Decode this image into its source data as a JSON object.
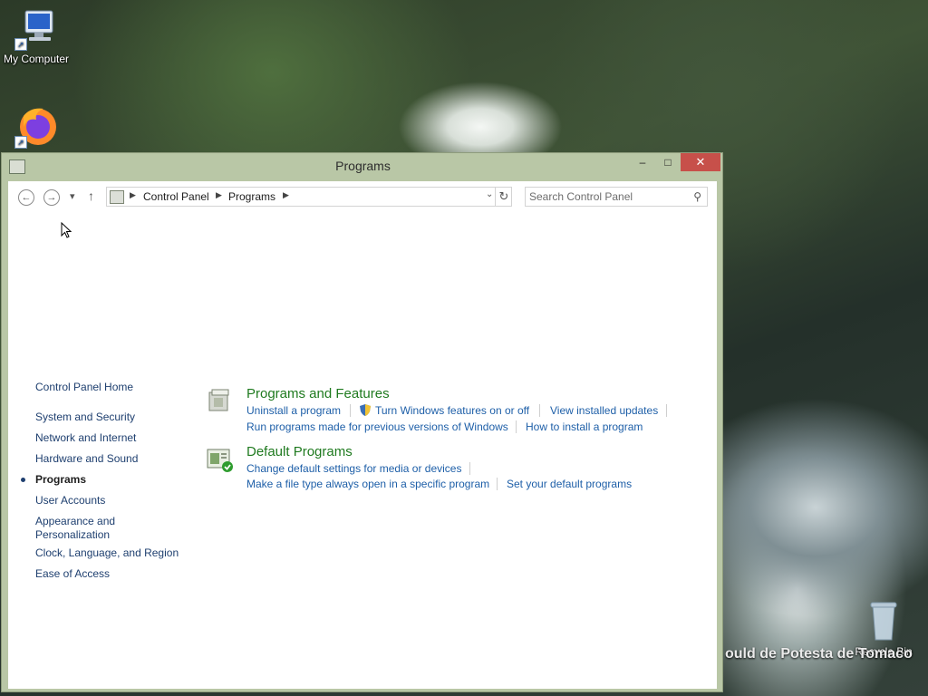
{
  "desktop": {
    "icons": [
      {
        "label": "My Computer"
      },
      {
        "label": ""
      },
      {
        "label": "Recycle Bin"
      }
    ],
    "watermark": "ould de Potesta de Tomaco"
  },
  "window": {
    "title": "Programs",
    "buttons": {
      "minimize": "–",
      "maximize": "□",
      "close": "✕"
    }
  },
  "address": {
    "breadcrumb": [
      "Control Panel",
      "Programs"
    ],
    "search_placeholder": "Search Control Panel"
  },
  "leftnav": {
    "items": [
      {
        "label": "Control Panel Home",
        "active": false
      },
      {
        "label": "System and Security",
        "active": false
      },
      {
        "label": "Network and Internet",
        "active": false
      },
      {
        "label": "Hardware and Sound",
        "active": false
      },
      {
        "label": "Programs",
        "active": true
      },
      {
        "label": "User Accounts",
        "active": false
      },
      {
        "label": "Appearance and Personalization",
        "active": false
      },
      {
        "label": "Clock, Language, and Region",
        "active": false
      },
      {
        "label": "Ease of Access",
        "active": false
      }
    ]
  },
  "sections": [
    {
      "title": "Programs and Features",
      "links": [
        "Uninstall a program",
        "Turn Windows features on or off",
        "View installed updates",
        "Run programs made for previous versions of Windows",
        "How to install a program"
      ]
    },
    {
      "title": "Default Programs",
      "links": [
        "Change default settings for media or devices",
        "Make a file type always open in a specific program",
        "Set your default programs"
      ]
    }
  ],
  "colors": {
    "link": "#1e5fa8",
    "section_title": "#1f7a1f",
    "close_button": "#c7504a",
    "window_frame": "#b9c7a6"
  }
}
